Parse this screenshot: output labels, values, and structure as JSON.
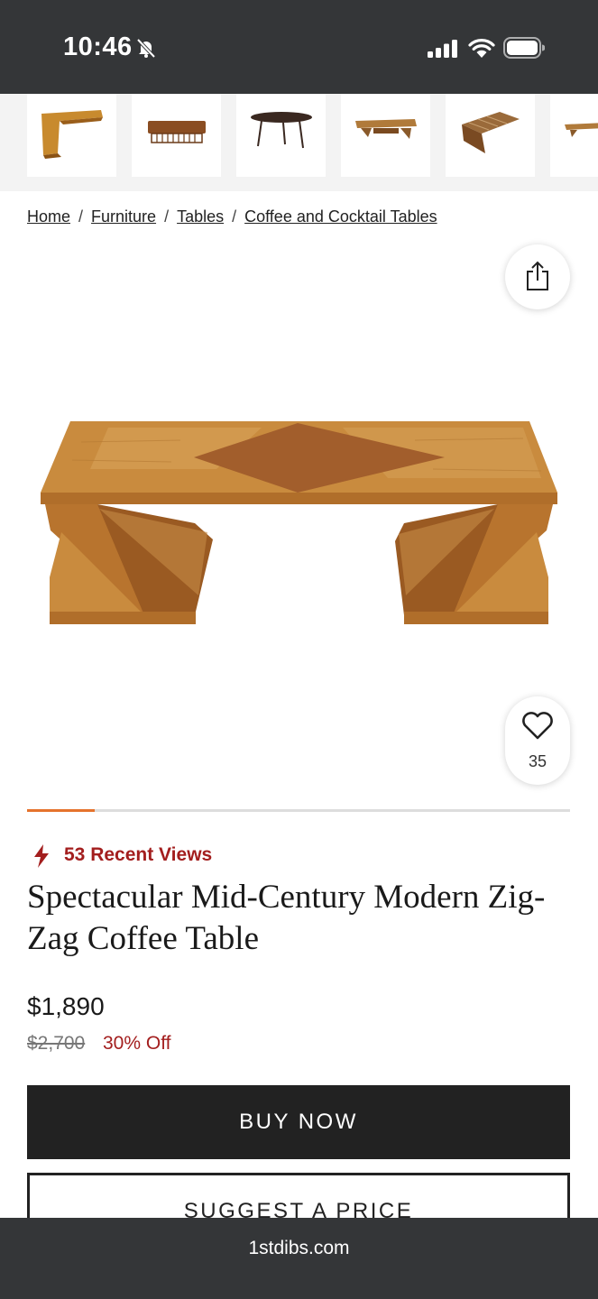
{
  "status_bar": {
    "time": "10:46",
    "icons": [
      "bell-slash-icon",
      "cellular-signal-icon",
      "wifi-icon",
      "battery-icon"
    ]
  },
  "thumbnails": [
    {
      "label": "thumbnail-1"
    },
    {
      "label": "thumbnail-2"
    },
    {
      "label": "thumbnail-3"
    },
    {
      "label": "thumbnail-4"
    },
    {
      "label": "thumbnail-5"
    },
    {
      "label": "thumbnail-6"
    }
  ],
  "breadcrumb": {
    "items": [
      "Home",
      "Furniture",
      "Tables",
      "Coffee and Cocktail Tables"
    ],
    "separator": "/"
  },
  "product": {
    "favorites_count": "35",
    "recent_views": "53 Recent Views",
    "title": "Spectacular Mid-Century Modern Zig-Zag Coffee Table",
    "price": "$1,890",
    "original_price": "$2,700",
    "discount": "30% Off",
    "gallery_progress": 0.125
  },
  "actions": {
    "buy_now": "BUY NOW",
    "suggest_price": "SUGGEST A PRICE"
  },
  "browser": {
    "domain": "1stdibs.com"
  },
  "colors": {
    "status_bar_bg": "#343638",
    "accent_red": "#a31e1e",
    "progress_orange": "#e5732d",
    "button_dark": "#222222"
  }
}
